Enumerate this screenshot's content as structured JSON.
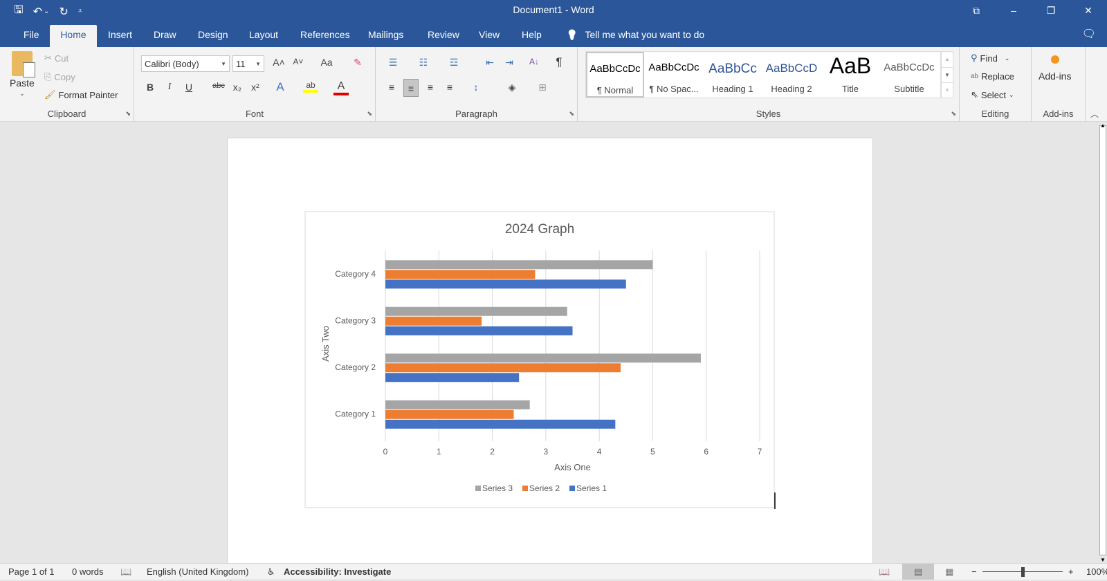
{
  "window": {
    "title": "Document1  -  Word",
    "controls": {
      "ribbon_display": "⧉",
      "minimize": "–",
      "restore": "❐",
      "close": "✕"
    }
  },
  "qat": {
    "save": "🖫",
    "undo": "↶",
    "undo_dd": "⌄",
    "redo": "↻",
    "customize": "⩡"
  },
  "tabs": [
    {
      "label": "File"
    },
    {
      "label": "Home",
      "active": true
    },
    {
      "label": "Insert"
    },
    {
      "label": "Draw"
    },
    {
      "label": "Design"
    },
    {
      "label": "Layout"
    },
    {
      "label": "References"
    },
    {
      "label": "Mailings"
    },
    {
      "label": "Review"
    },
    {
      "label": "View"
    },
    {
      "label": "Help"
    }
  ],
  "tellme": {
    "icon": "💡",
    "text": "Tell me what you want to do"
  },
  "ribbon": {
    "clipboard": {
      "paste": "Paste",
      "cut": "Cut",
      "copy": "Copy",
      "format_painter": "Format Painter",
      "label": "Clipboard"
    },
    "font": {
      "font_name": "Calibri (Body)",
      "font_size": "11",
      "label": "Font",
      "buttons": {
        "grow": "A˄",
        "shrink": "A˅",
        "case": "Aa",
        "clear": "✎",
        "bold": "B",
        "italic": "I",
        "underline": "U",
        "strike": "abc",
        "sub": "x₂",
        "sup": "x²",
        "effects": "A",
        "highlight": "ab",
        "color": "A"
      },
      "highlight_color": "#ffff00",
      "font_color": "#e00000"
    },
    "paragraph": {
      "label": "Paragraph",
      "buttons": {
        "bullets": "☰",
        "numbering": "☷",
        "multilevel": "☲",
        "dec_indent": "⇤",
        "inc_indent": "⇥",
        "sort": "A↓",
        "pilcrow": "¶",
        "align_left": "≡",
        "center": "≡",
        "align_right": "≡",
        "justify": "≡",
        "line_spacing": "↕",
        "shading": "◈",
        "borders": "⊞"
      }
    },
    "styles": {
      "label": "Styles",
      "items": [
        {
          "preview": "AaBbCcDc",
          "name": "¶ Normal",
          "color": "#000000",
          "selected": true
        },
        {
          "preview": "AaBbCcDc",
          "name": "¶ No Spac...",
          "color": "#000000"
        },
        {
          "preview": "AaBbCc",
          "name": "Heading 1",
          "color": "#2f5496"
        },
        {
          "preview": "AaBbCcD",
          "name": "Heading 2",
          "color": "#2f5496"
        },
        {
          "preview": "AaB",
          "name": "Title",
          "color": "#000000"
        },
        {
          "preview": "AaBbCcDc",
          "name": "Subtitle",
          "color": "#595959"
        }
      ]
    },
    "editing": {
      "label": "Editing",
      "find": "Find",
      "replace": "Replace",
      "select": "Select"
    },
    "addins": {
      "label": "Add-ins",
      "button": "Add-ins"
    }
  },
  "chart_data": {
    "type": "bar",
    "orientation": "horizontal",
    "title": "2024 Graph",
    "xlabel": "Axis One",
    "ylabel": "Axis Two",
    "categories": [
      "Category 1",
      "Category 2",
      "Category 3",
      "Category 4"
    ],
    "series": [
      {
        "name": "Series 1",
        "color": "#4472c4",
        "values": [
          4.3,
          2.5,
          3.5,
          4.5
        ]
      },
      {
        "name": "Series 2",
        "color": "#ed7d31",
        "values": [
          2.4,
          4.4,
          1.8,
          2.8
        ]
      },
      {
        "name": "Series 3",
        "color": "#a5a5a5",
        "values": [
          2.7,
          5.9,
          3.4,
          5.0
        ]
      }
    ],
    "xlim": [
      0,
      7
    ],
    "xticks": [
      "0",
      "1",
      "2",
      "3",
      "4",
      "5",
      "6",
      "7"
    ],
    "grid": true,
    "legend": "bottom",
    "legend_order": [
      "Series 3",
      "Series 2",
      "Series 1"
    ]
  },
  "status": {
    "page": "Page 1 of 1",
    "words": "0 words",
    "proofing_icon": "📖",
    "language": "English (United Kingdom)",
    "accessibility": "Accessibility: Investigate",
    "zoom": "100%",
    "zoom_minus": "−",
    "zoom_plus": "+"
  }
}
